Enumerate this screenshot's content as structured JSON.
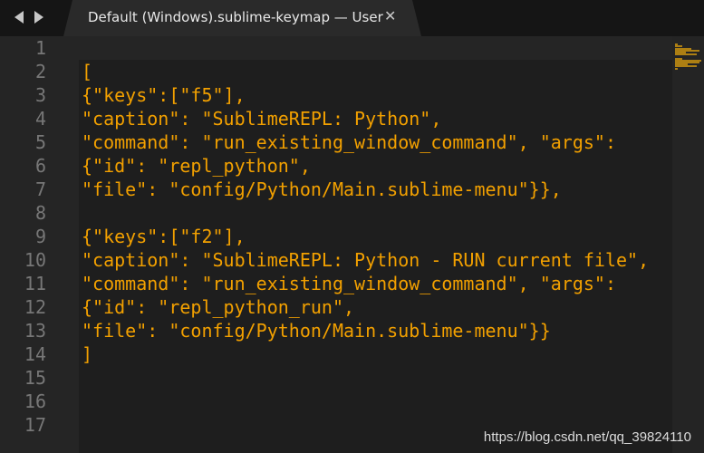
{
  "titlebar": {
    "nav_back_icon": "triangle-left",
    "nav_forward_icon": "triangle-right",
    "tab_title": "Default (Windows).sublime-keymap — User",
    "tab_close": "✕"
  },
  "editor": {
    "line_numbers": [
      "1",
      "2",
      "3",
      "4",
      "5",
      "6",
      "7",
      "8",
      "9",
      "10",
      "11",
      "12",
      "13",
      "14",
      "15",
      "16",
      "17"
    ],
    "lines": [
      "",
      "[",
      "{\"keys\":[\"f5\"],",
      "\"caption\": \"SublimeREPL: Python\",",
      "\"command\": \"run_existing_window_command\", \"args\":",
      "{\"id\": \"repl_python\",",
      "\"file\": \"config/Python/Main.sublime-menu\"}},",
      "",
      "{\"keys\":[\"f2\"],",
      "\"caption\": \"SublimeREPL: Python - RUN current file\",",
      "\"command\": \"run_existing_window_command\", \"args\":",
      "{\"id\": \"repl_python_run\",",
      "\"file\": \"config/Python/Main.sublime-menu\"}}",
      "]",
      "",
      "",
      ""
    ]
  },
  "watermark": "https://blog.csdn.net/qq_39824110",
  "colors": {
    "code_text": "#f2a000",
    "line_number": "#777777",
    "background": "#1e1e1e"
  }
}
